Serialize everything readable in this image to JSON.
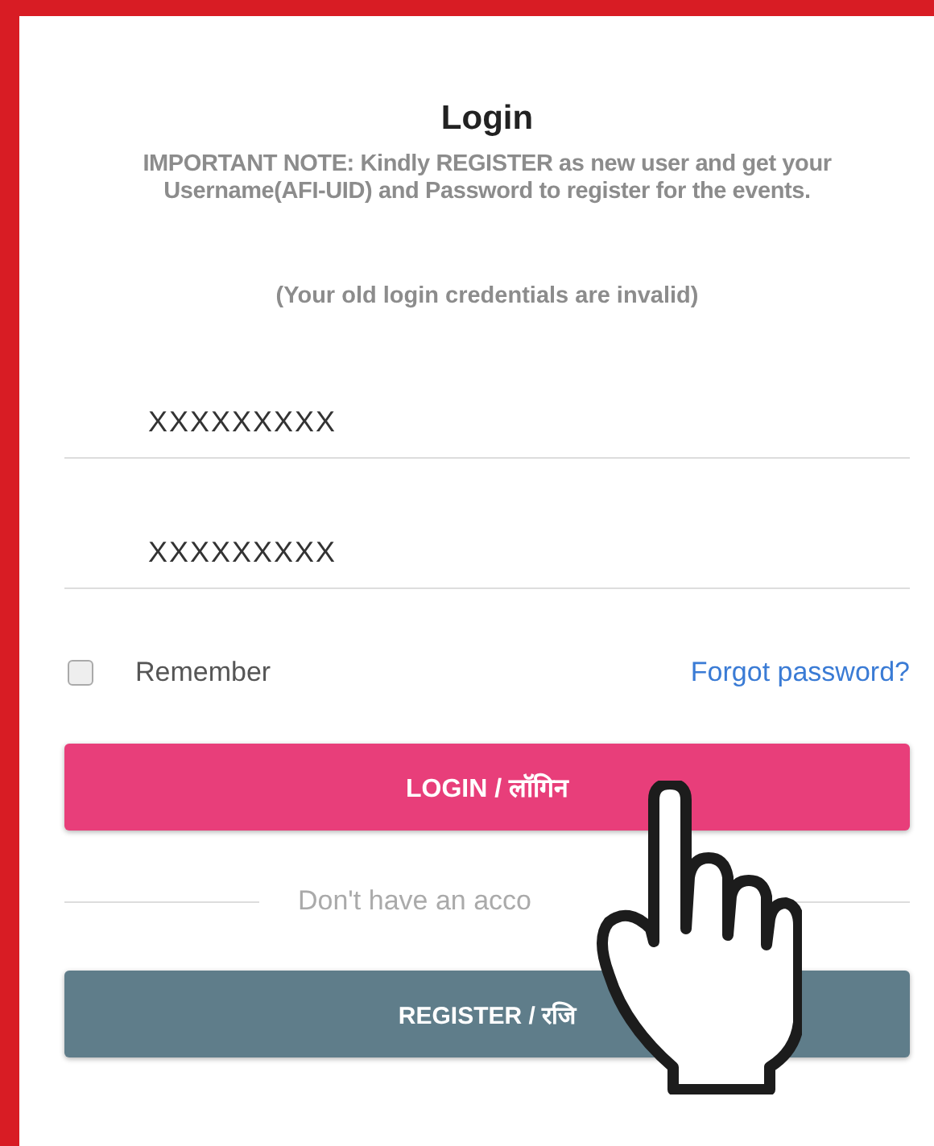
{
  "title": "Login",
  "note": "IMPORTANT NOTE: Kindly REGISTER as new user and get your Username(AFI-UID) and Password to register for the events.",
  "subnote": "(Your old login credentials are invalid)",
  "fields": [
    {
      "value": "XXXXXXXXX"
    },
    {
      "value": "XXXXXXXXX"
    }
  ],
  "remember": {
    "label": "Remember",
    "checked": false
  },
  "forgot_link": "Forgot password?",
  "login_button": "LOGIN / लॉगिन",
  "divider_text": "Don't have an acco",
  "register_button": "REGISTER / रजि"
}
